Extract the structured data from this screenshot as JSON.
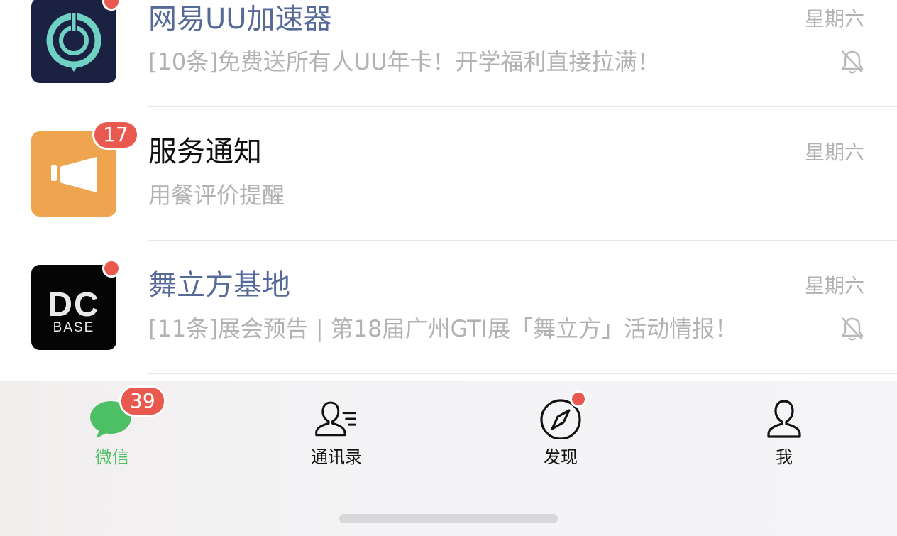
{
  "chats": [
    {
      "name": "网易UU加速器",
      "preview": "[10条]免费送所有人UU年卡！开学福利直接拉满！",
      "time": "星期六",
      "muted": true,
      "unread_dot": true,
      "avatar_icon": "uu-booster-logo"
    },
    {
      "name": "服务通知",
      "preview": "用餐评价提醒",
      "time": "星期六",
      "muted": false,
      "unread_count": "17",
      "avatar_icon": "megaphone-icon"
    },
    {
      "name": "舞立方基地",
      "preview": "[11条]展会预告 | 第18届广州GTI展「舞立方」活动情报！",
      "time": "星期六",
      "muted": true,
      "unread_dot": true,
      "avatar_icon": "dcbase-logo",
      "avatar_text_top": "DC",
      "avatar_text_bottom": "BASE"
    }
  ],
  "tabbar": {
    "tabs": [
      {
        "label": "微信",
        "icon": "chat-bubble-icon",
        "active": true,
        "badge": "39"
      },
      {
        "label": "通讯录",
        "icon": "contacts-icon",
        "active": false
      },
      {
        "label": "发现",
        "icon": "compass-icon",
        "active": false,
        "dot": true
      },
      {
        "label": "我",
        "icon": "person-icon",
        "active": false
      }
    ]
  },
  "colors": {
    "accent_green": "#4dbf64",
    "badge_red": "#e9594f",
    "official_name": "#566a99",
    "secondary_text": "#b2b2b2",
    "uu_bg": "#1b2140",
    "uu_ring": "#6fd0c4",
    "service_bg": "#efa450"
  }
}
